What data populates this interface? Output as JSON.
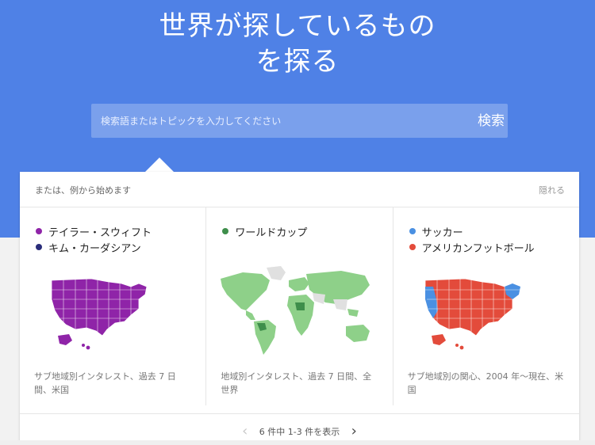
{
  "colors": {
    "hero_blue": "#4f81e6",
    "purple": "#8f24a8",
    "navy": "#2a2d7a",
    "green": "#3e8e4b",
    "light_green": "#8ed089",
    "blue": "#4a90e2",
    "red": "#e34b3b"
  },
  "hero": {
    "title_line1": "世界が探しているもの",
    "title_line2": "を探る"
  },
  "search": {
    "placeholder": "検索語またはトピックを入力してください",
    "button_label": "検索"
  },
  "panel": {
    "header_text": "または、例から始めます",
    "hide_label": "隠れる",
    "cards": [
      {
        "legend": [
          {
            "label": "テイラー・スウィフト",
            "color": "#8f24a8"
          },
          {
            "label": "キム・カーダシアン",
            "color": "#2a2d7a"
          }
        ],
        "caption": "サブ地域別インタレスト、過去 7 日間、米国"
      },
      {
        "legend": [
          {
            "label": "ワールドカップ",
            "color": "#3e8e4b"
          }
        ],
        "caption": "地域別インタレスト、過去 7 日間、全世界"
      },
      {
        "legend": [
          {
            "label": "サッカー",
            "color": "#4a90e2"
          },
          {
            "label": "アメリカンフットボール",
            "color": "#e34b3b"
          }
        ],
        "caption": "サブ地域別の関心、2004 年〜現在、米国"
      }
    ],
    "pagination": {
      "text": "6 件中 1-3 件を表示",
      "prev_icon": "chevron-left-icon",
      "next_icon": "chevron-right-icon"
    }
  }
}
